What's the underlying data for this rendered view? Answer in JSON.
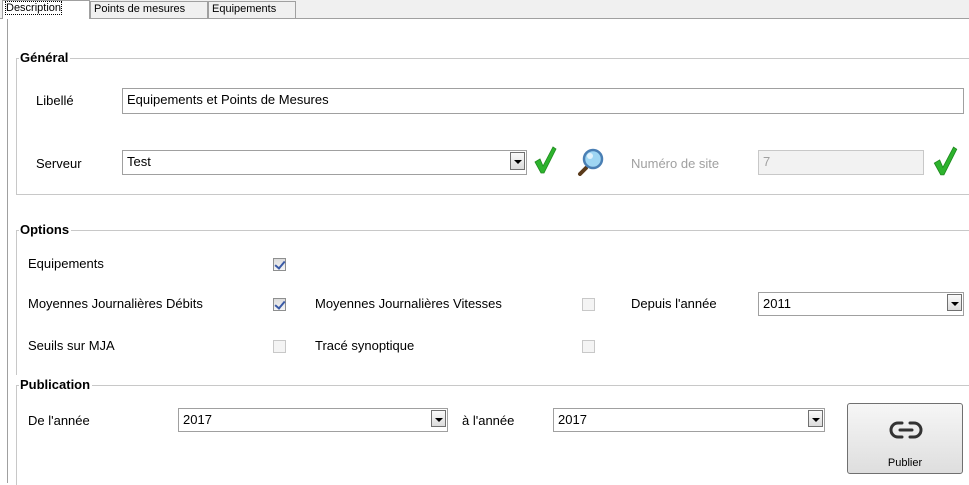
{
  "tabs": [
    {
      "label": "Description",
      "active": true
    },
    {
      "label": "Points de mesures",
      "active": false
    },
    {
      "label": "Equipements",
      "active": false
    }
  ],
  "general": {
    "legend": "Général",
    "libelle_label": "Libellé",
    "libelle_value": "Equipements et Points de Mesures",
    "serveur_label": "Serveur",
    "serveur_value": "Test",
    "check_icon": "green-checkmark-icon",
    "search_icon": "magnifier-icon",
    "site_label": "Numéro de site",
    "site_value": "7"
  },
  "options": {
    "legend": "Options",
    "equipements_label": "Equipements",
    "equipements_checked": true,
    "mjd_label": "Moyennes Journalières Débits",
    "mjd_checked": true,
    "mjv_label": "Moyennes Journalières Vitesses",
    "mjv_checked": false,
    "depuis_label": "Depuis l'année",
    "depuis_value": "2011",
    "seuils_label": "Seuils sur MJA",
    "seuils_checked": false,
    "synoptique_label": "Tracé synoptique",
    "synoptique_checked": false
  },
  "publication": {
    "legend": "Publication",
    "de_label": "De l'année",
    "de_value": "2017",
    "a_label": "à l'année",
    "a_value": "2017",
    "publish_label": "Publier",
    "publish_icon": "link-icon"
  },
  "colors": {
    "check_green": "#2db32d",
    "disabled_text": "#a0a0a0",
    "group_border": "#c8c8c8"
  }
}
